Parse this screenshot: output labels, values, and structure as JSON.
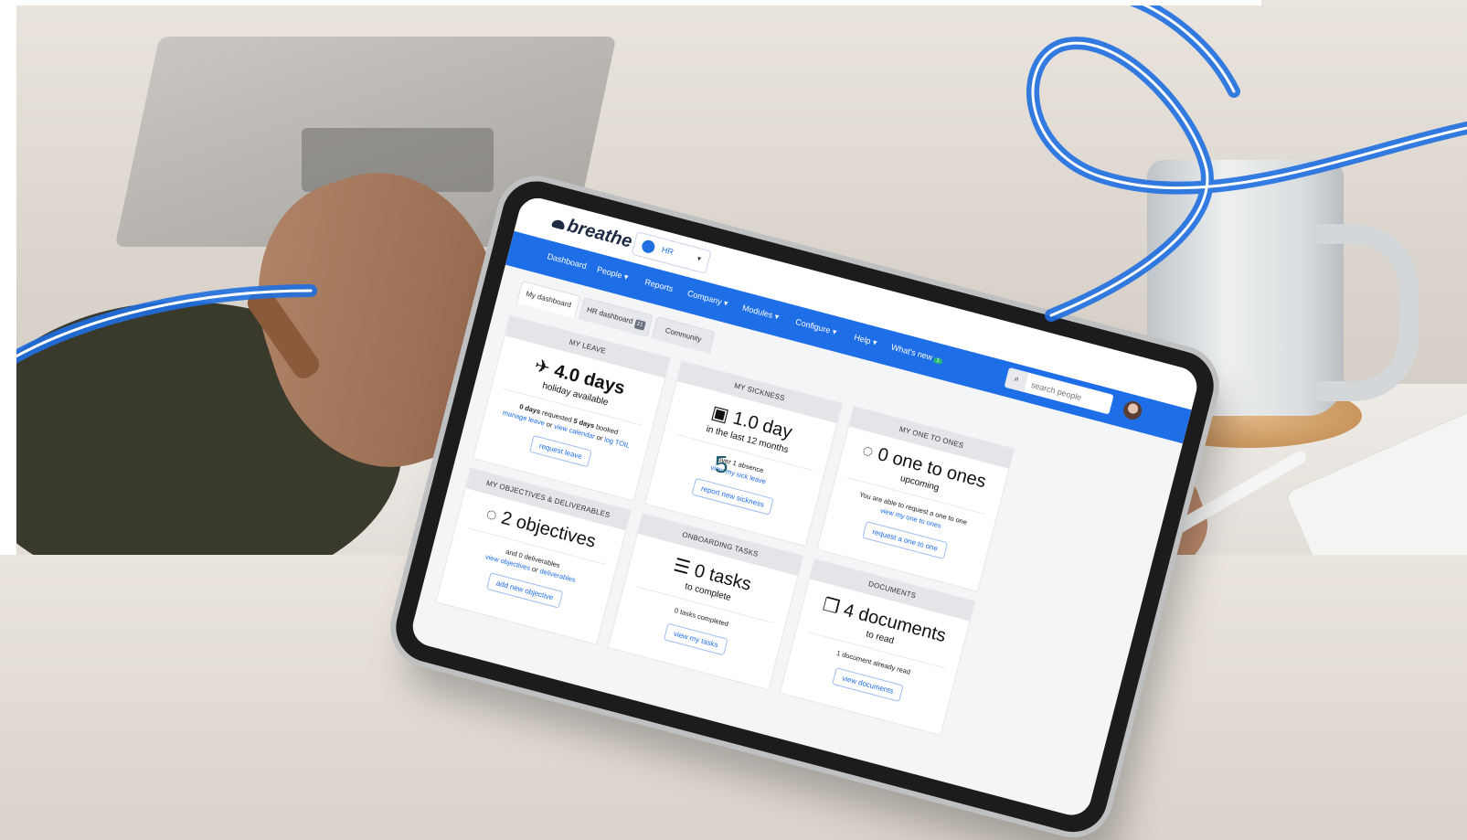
{
  "colors": {
    "brand": "#1e6ee8",
    "text": "#111111",
    "panel_head": "#e3e5e8",
    "neon": "#1f6fe0"
  },
  "app": {
    "logo": "breathe",
    "department": "HR"
  },
  "nav": {
    "items": [
      "Dashboard",
      "People",
      "Reports",
      "Company",
      "Modules",
      "Configure",
      "Help",
      "What's new"
    ],
    "dropdown_flags": [
      false,
      true,
      false,
      true,
      true,
      true,
      true,
      false
    ],
    "whats_new_count": "1",
    "search_placeholder": "search people"
  },
  "tabs": [
    {
      "label": "My dashboard",
      "active": true
    },
    {
      "label": "HR dashboard",
      "badge": "21"
    },
    {
      "label": "Community"
    }
  ],
  "panels": {
    "leave": {
      "title": "MY LEAVE",
      "icon": "plane-icon",
      "value": "4.0 days",
      "subtitle": "holiday available",
      "requested_days": "0 days",
      "requested_text": "requested",
      "booked_days": "5 days",
      "booked_text": "booked",
      "link_manage": "manage leave",
      "sep_or1": "or",
      "link_calendar": "view calendar",
      "sep_or2": "or",
      "link_toil": "log TOIL",
      "button": "request leave"
    },
    "sickness": {
      "title": "MY SICKNESS",
      "icon": "medical-bag-icon",
      "value": "1.0 day",
      "subtitle": "in the last 12 months",
      "note": "over 1 absence",
      "link": "view my sick leave",
      "button": "report new sickness"
    },
    "one_to_ones": {
      "title": "MY ONE TO ONES",
      "icon": "speech-bubble-icon",
      "value": "0 one to ones",
      "subtitle": "upcoming",
      "note": "You are able to request a one to one",
      "link": "view my one to ones",
      "button": "request a one to one"
    },
    "objectives": {
      "title": "MY OBJECTIVES & DELIVERABLES",
      "icon": "speech-bubble-icon",
      "value": "2 objectives",
      "note": "and 0 deliverables",
      "link_objectives": "view objectives",
      "sep_or": "or",
      "link_deliverables": "deliverables",
      "button": "add new objective"
    },
    "onboarding": {
      "title": "ONBOARDING TASKS",
      "icon": "list-icon",
      "value": "0 tasks",
      "subtitle": "to complete",
      "note": "0 tasks completed",
      "button": "view my tasks"
    },
    "documents": {
      "title": "DOCUMENTS",
      "icon": "documents-icon",
      "value": "4 documents",
      "subtitle": "to read",
      "note": "1 document already read",
      "button": "view documents"
    }
  },
  "overlay_number": "5"
}
